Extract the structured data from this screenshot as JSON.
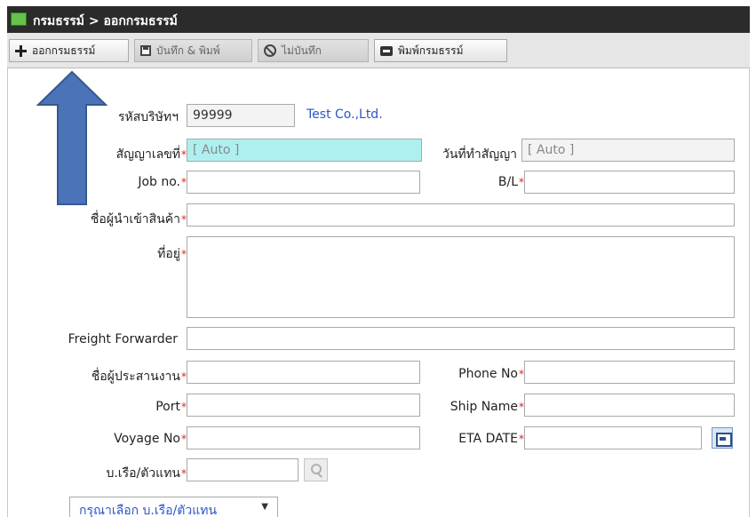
{
  "window": {
    "breadcrumb": "กรมธรรม์ > ออกกรมธรรม์"
  },
  "toolbar": {
    "new_label": "ออกกรมธรรม์",
    "save_print_label": "บันทึก & พิมพ์",
    "cancel_label": "ไม่บันทึก",
    "print_label": "พิมพ์กรมธรรม์"
  },
  "form": {
    "company_code_label": "รหัสบริษัทฯ",
    "company_code_value": "99999",
    "company_name": "Test Co.,Ltd.",
    "contract_no_label": "สัญญาเลขที่",
    "contract_no_value": "[ Auto ]",
    "contract_date_label": "วันที่ทำสัญญา",
    "contract_date_value": "[ Auto ]",
    "job_no_label": "Job no.",
    "bl_label": "B/L",
    "importer_label": "ชื่อผู้นำเข้าสินค้า",
    "address_label": "ที่อยู่",
    "forwarder_label": "Freight Forwarder",
    "coordinator_label": "ชื่อผู้ประสานงาน",
    "phone_label": "Phone No",
    "port_label": "Port",
    "ship_name_label": "Ship Name",
    "voyage_label": "Voyage No",
    "eta_label": "ETA DATE",
    "agent_label": "บ.เรือ/ตัวแทน",
    "agent_select": "กรุณาเลือก บ.เรือ/ตัวแทน",
    "required_mark": "*"
  },
  "colors": {
    "accent_arrow": "#4a73b8",
    "highlight_field": "#aef0ef",
    "required": "#e01e1e",
    "link_text": "#2c55c8"
  },
  "icons": [
    "plus-icon",
    "save-icon",
    "cancel-icon",
    "print-icon",
    "calendar-icon",
    "search-icon",
    "chevron-down-icon",
    "arrow-up-icon"
  ]
}
